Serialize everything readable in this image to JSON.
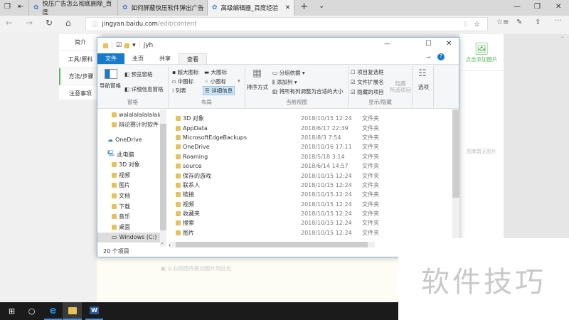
{
  "browser": {
    "tabs": [
      "快压广告怎么彻底删除_百度",
      "如何屏蔽快压软件弹出广告",
      "高级编辑器_百度经验"
    ],
    "url_host": "jingyan.baidu.com",
    "url_path": "/edit/content",
    "new_tab": "+",
    "tab_menu": "⌄"
  },
  "page": {
    "left_nav": [
      "简介",
      "工具/原料",
      "方法/步骤",
      "注意事项"
    ],
    "add_image": "点击添加图片",
    "no_image": "图库暂无图片",
    "drag_hint": "从右侧图库拖动图片到此处",
    "accent": "#5cb85c"
  },
  "explorer": {
    "title": "jyh",
    "ribbon_tabs": [
      "文件",
      "主页",
      "共享",
      "查看"
    ],
    "panes": {
      "nav": "导航窗格",
      "preview": "预览窗格",
      "details": "详细信息窗格",
      "label": "窗格"
    },
    "layout": {
      "items": [
        "超大图标",
        "大图标",
        "中图标",
        "小图标",
        "列表",
        "详细信息"
      ],
      "label": "布局"
    },
    "view": {
      "sort": "排序方式",
      "group": "分组依据 ▾",
      "add_col": "添加列 ▾",
      "fit": "将所有列调整为合适的大小",
      "label": "当前视图"
    },
    "show": {
      "checkbox_items": "项目复选框",
      "ext": "文件扩展名",
      "hidden": "隐藏的项目",
      "hide_sel": "隐藏\n所选项目",
      "label": "显示/隐藏",
      "checkbox_items_checked": false,
      "ext_checked": true,
      "hidden_checked": true
    },
    "options": "选项",
    "nav_items": [
      {
        "label": "walalalalalalala",
        "indent": 1
      },
      {
        "label": "辩论赛计时软件",
        "indent": 1
      },
      {
        "label": "OneDrive",
        "indent": 0
      },
      {
        "label": "此电脑",
        "indent": 0
      },
      {
        "label": "3D 对象",
        "indent": 1
      },
      {
        "label": "视频",
        "indent": 1
      },
      {
        "label": "图片",
        "indent": 1
      },
      {
        "label": "文档",
        "indent": 1
      },
      {
        "label": "下载",
        "indent": 1
      },
      {
        "label": "音乐",
        "indent": 1
      },
      {
        "label": "桌面",
        "indent": 1
      },
      {
        "label": "Windows (C:)",
        "indent": 1
      }
    ],
    "files": [
      {
        "name": "3D 对象",
        "date": "2018/10/15 12:24",
        "type": "文件夹"
      },
      {
        "name": "AppData",
        "date": "2018/6/17 22:39",
        "type": "文件夹"
      },
      {
        "name": "MicrosoftEdgeBackups",
        "date": "2018/8/3 7:54",
        "type": "文件夹"
      },
      {
        "name": "OneDrive",
        "date": "2018/10/16 17:11",
        "type": "文件夹"
      },
      {
        "name": "Roaming",
        "date": "2018/5/18 3:14",
        "type": "文件夹"
      },
      {
        "name": "source",
        "date": "2018/6/14 14:57",
        "type": "文件夹"
      },
      {
        "name": "保存的游戏",
        "date": "2018/10/15 12:24",
        "type": "文件夹"
      },
      {
        "name": "联系人",
        "date": "2018/10/15 12:24",
        "type": "文件夹"
      },
      {
        "name": "链接",
        "date": "2018/10/15 12:24",
        "type": "文件夹"
      },
      {
        "name": "视频",
        "date": "2018/10/15 12:24",
        "type": "文件夹"
      },
      {
        "name": "收藏夹",
        "date": "2018/10/15 12:24",
        "type": "文件夹"
      },
      {
        "name": "搜索",
        "date": "2018/10/15 12:24",
        "type": "文件夹"
      },
      {
        "name": "图片",
        "date": "2018/10/15 12:24",
        "type": "文件夹"
      }
    ],
    "status": "20 个项目"
  },
  "watermark": "软件技巧"
}
